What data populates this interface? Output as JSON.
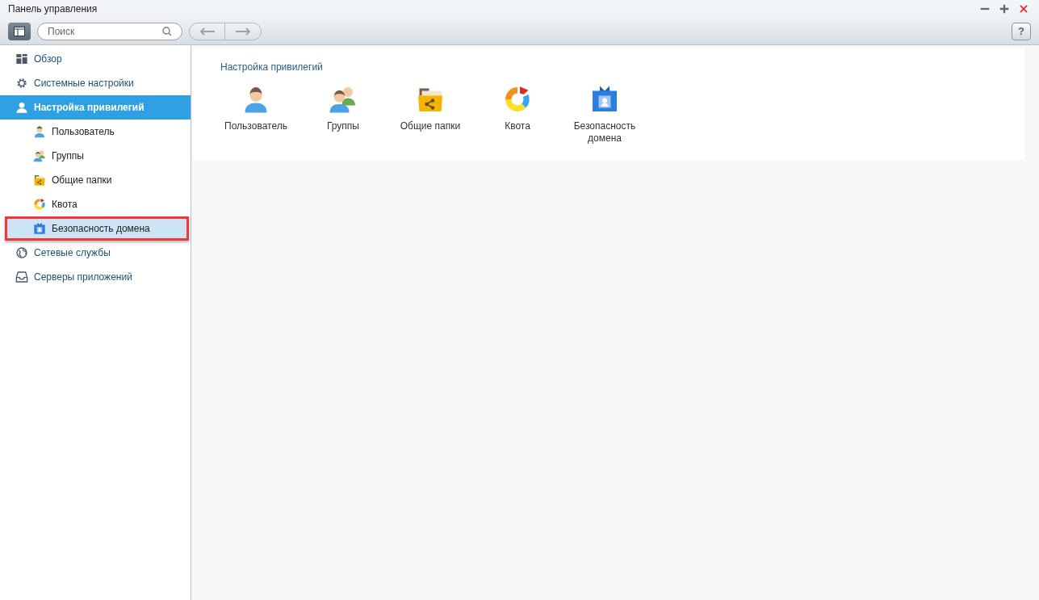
{
  "window": {
    "title": "Панель управления"
  },
  "toolbar": {
    "search": {
      "placeholder": "Поиск"
    },
    "help": "?"
  },
  "sidebar": {
    "items": [
      {
        "label": "Обзор",
        "selected": false,
        "highlighted": false
      },
      {
        "label": "Системные настройки",
        "selected": false,
        "highlighted": false
      },
      {
        "label": "Настройка привилегий",
        "selected": true,
        "highlighted": false,
        "children": [
          {
            "label": "Пользователь",
            "selected": false,
            "highlighted": false
          },
          {
            "label": "Группы",
            "selected": false,
            "highlighted": false
          },
          {
            "label": "Общие папки",
            "selected": false,
            "highlighted": false
          },
          {
            "label": "Квота",
            "selected": false,
            "highlighted": false
          },
          {
            "label": "Безопасность домена",
            "selected": false,
            "highlighted": true
          }
        ]
      },
      {
        "label": "Сетевые службы",
        "selected": false,
        "highlighted": false
      },
      {
        "label": "Серверы приложений",
        "selected": false,
        "highlighted": false
      }
    ]
  },
  "panel": {
    "title": "Настройка привилегий",
    "tiles": [
      {
        "label": "Пользователь"
      },
      {
        "label": "Группы"
      },
      {
        "label": "Общие папки"
      },
      {
        "label": "Квота"
      },
      {
        "label": "Безопасность домена"
      }
    ]
  }
}
